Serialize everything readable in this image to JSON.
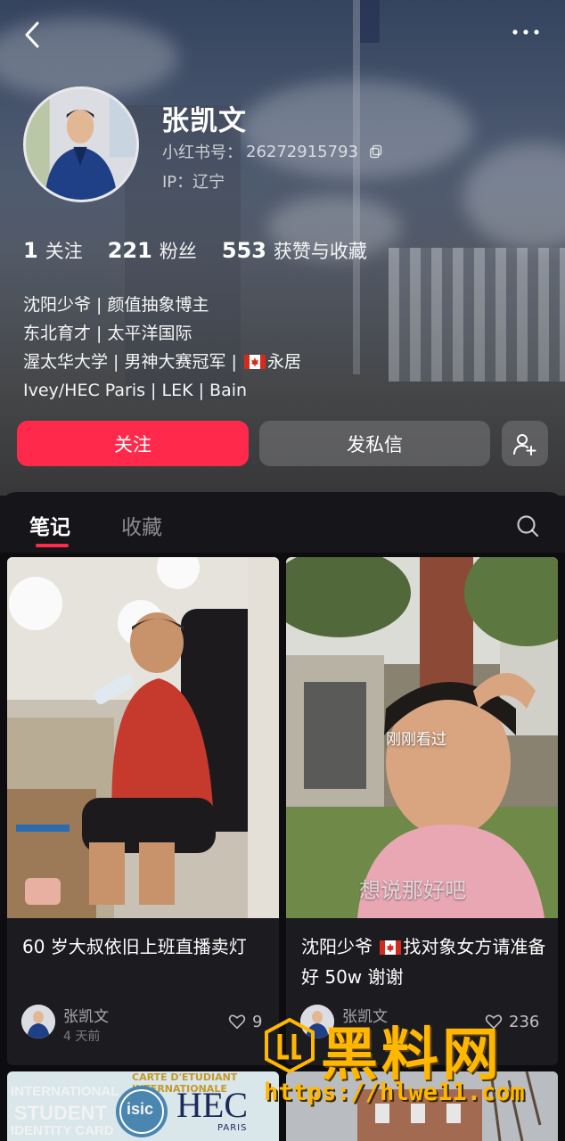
{
  "profile": {
    "name": "张凯文",
    "xhs_id_label": "小红书号：",
    "xhs_id": "26272915793",
    "ip": "IP：辽宁"
  },
  "stats": [
    {
      "num": "1",
      "label": "关注"
    },
    {
      "num": "221",
      "label": "粉丝"
    },
    {
      "num": "553",
      "label": "获赞与收藏"
    }
  ],
  "bio": {
    "line1": "沈阳少爷 | 颜值抽象博主",
    "line2": "东北育才 | 太平洋国际",
    "line3_a": "渥太华大学 | 男神大赛冠军 | ",
    "line3_b": "永居",
    "line4": "Ivey/HEC Paris  |  LEK  |  Bain"
  },
  "actions": {
    "follow": "关注",
    "message": "发私信"
  },
  "tabs": {
    "notes": "笔记",
    "collections": "收藏"
  },
  "posts": [
    {
      "title": "60 岁大叔依旧上班直播卖灯",
      "author": "张凯文",
      "time": "4 天前",
      "likes": "9"
    },
    {
      "title_a": "沈阳少爷 ",
      "title_b": "找对象女方请准备好 50w 谢谢",
      "author": "张凯文",
      "likes": "236",
      "seen_label": "刚刚看过",
      "subtitle": "想说那好吧"
    }
  ],
  "post3_image_text": {
    "line1": "INTERNATIONAL",
    "line2": "STUDENT",
    "line3": "IDENTITY CARD",
    "badge": "isic",
    "school": "HEC",
    "city": "PARIS",
    "ribbon": "CARTE D'ETUDIANT INTERNATIONALE"
  },
  "watermark": {
    "title": "黑料网",
    "url": "https://hlwe11.com"
  },
  "colors": {
    "accent": "#ff2a4b",
    "watermark": "#ffb700"
  }
}
